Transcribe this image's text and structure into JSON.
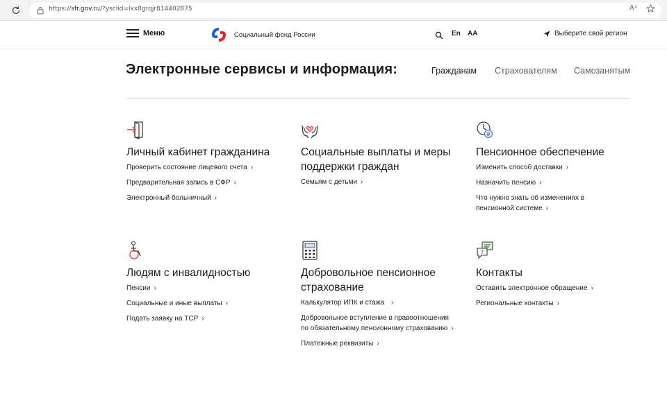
{
  "browser": {
    "url_prefix": "https://",
    "url_domain": "sfr.gov.ru",
    "url_rest": "/?ysclid=lxx8grqjr814402875",
    "read_aloud": "A⁴"
  },
  "header": {
    "menu_label": "Меню",
    "brand_name": "Социальный фонд России",
    "lang_label": "En",
    "font_size_label": "AA",
    "region_label": "Выберите свой регион",
    "brand_color": "#1d5bd7",
    "accent_red": "#e42424"
  },
  "section": {
    "title": "Электронные сервисы и информация:",
    "tabs": [
      {
        "label": "Гражданам",
        "active": true
      },
      {
        "label": "Страхователям",
        "active": false
      },
      {
        "label": "Самозанятым",
        "active": false
      }
    ]
  },
  "cards": [
    {
      "icon": "login-door-icon",
      "title": "Личный кабинет гражданина",
      "links": [
        "Проверить состояние лицевого счета",
        "Предварительная запись в СФР",
        "Электронный больничный"
      ]
    },
    {
      "icon": "hands-heart-icon",
      "title": "Социальные выплаты и меры поддержки граждан",
      "links": [
        "Семьям с детьми"
      ]
    },
    {
      "icon": "pension-clock-icon",
      "title": "Пенсионное обеспечение",
      "links": [
        "Изменить способ доставки",
        "Назначить пенсию",
        "Что нужно знать об изменениях в пенсионной системе"
      ]
    },
    {
      "icon": "wheelchair-icon",
      "title": "Людям с инвалидностью",
      "links": [
        "Пенсии",
        "Социальные и иные выплаты",
        "Подать заявку на ТСР"
      ]
    },
    {
      "icon": "calculator-icon",
      "title": "Добровольное пенсионное страхование",
      "links": [
        "Калькулятор ИПК и стажа",
        "Добровольное вступление в правоотношения по обязательному пенсионному страхованию",
        "Платежные реквизиты"
      ]
    },
    {
      "icon": "chat-question-icon",
      "title": "Контакты",
      "links": [
        "Оставить электронное обращение",
        "Региональные контакты"
      ]
    }
  ]
}
